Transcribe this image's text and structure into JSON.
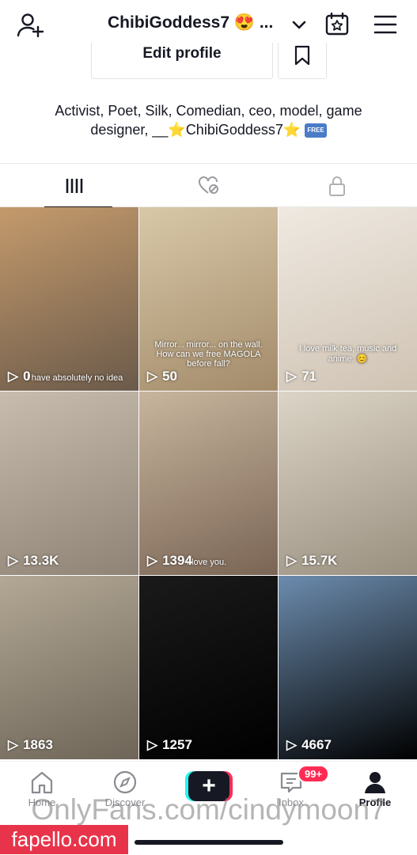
{
  "header": {
    "username": "ChibiGoddess7 😍 ...",
    "icons": [
      "add-user-icon",
      "chevron-down-icon",
      "calendar-star-icon",
      "menu-icon"
    ]
  },
  "profile": {
    "edit_label": "Edit profile",
    "bookmark_icon": "bookmark-icon",
    "bio_line1": "Activist, Poet, Silk, Comedian, ceo, model, game",
    "bio_line2_prefix": "designer, __",
    "bio_star": "⭐",
    "bio_name": "ChibiGoddess7",
    "bio_free": "FREE"
  },
  "tabs": [
    "videos-grid-icon",
    "liked-hidden-icon",
    "lock-icon"
  ],
  "videos": [
    {
      "views": "0",
      "caption": "I have absolutely no idea",
      "bg": [
        "#6b5a4a",
        "#c49a6c"
      ]
    },
    {
      "views": "50",
      "caption": "Mirror... mirror... on the wall. How can we free MAGOLA before fall?",
      "bg": [
        "#a38b6a",
        "#d8c8a8"
      ]
    },
    {
      "views": "71",
      "caption": "I love milk tea, music and anime. 😊",
      "bg": [
        "#cfc3b3",
        "#efe9e1"
      ]
    },
    {
      "views": "13.3K",
      "caption": "",
      "bg": [
        "#8f8375",
        "#c8bcae"
      ]
    },
    {
      "views": "1394",
      "caption": "I love you.",
      "bg": [
        "#7a6555",
        "#c7b59d"
      ]
    },
    {
      "views": "15.7K",
      "caption": "",
      "bg": [
        "#9a9080",
        "#dcd4c6"
      ]
    },
    {
      "views": "1863",
      "caption": "",
      "bg": [
        "#6e6558",
        "#b3a895"
      ]
    },
    {
      "views": "1257",
      "caption": "",
      "bg": [
        "#000000",
        "#1a1a1a"
      ]
    },
    {
      "views": "4667",
      "caption": "",
      "bg": [
        "#000000",
        "#6c8cae"
      ]
    }
  ],
  "nav": {
    "home": "Home",
    "discover": "Discover",
    "inbox": "Inbox",
    "inbox_badge": "99+",
    "profile": "Profile"
  },
  "watermark": "OnlyFans.com/cindymoon7",
  "site_badge": "fapello.com",
  "colors": {
    "accent": "#fe2c55",
    "cyan": "#25f4ee",
    "dark": "#161823",
    "fapello": "#e8344a"
  }
}
